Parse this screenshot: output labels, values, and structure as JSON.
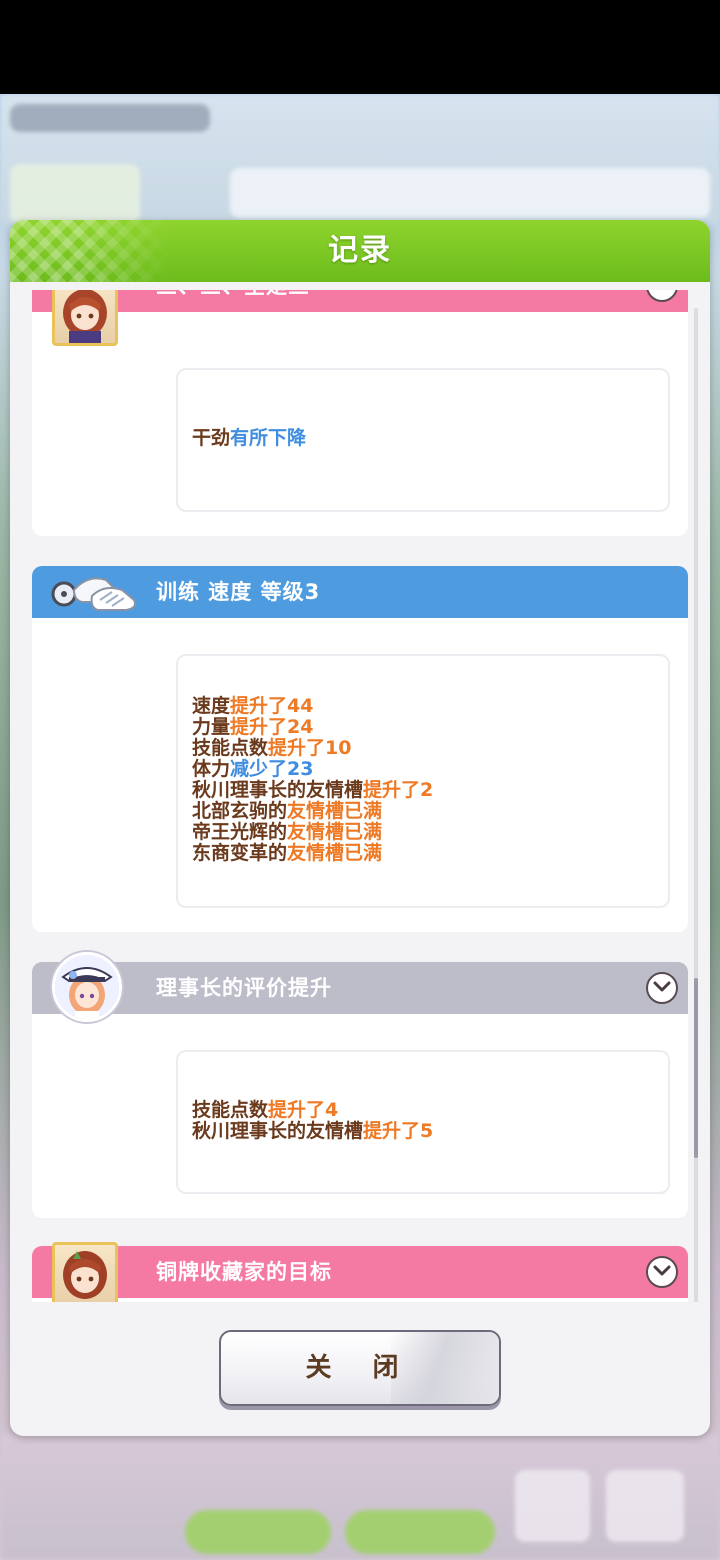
{
  "modal": {
    "title": "记录",
    "close_label": "关 闭"
  },
  "entries": [
    {
      "title": "三、三、全是三",
      "header_color": "#f57aa3",
      "icon": "character-portrait",
      "lines": [
        [
          {
            "text": "干劲",
            "color": "brown"
          },
          {
            "text": "有所下降",
            "color": "blue"
          }
        ]
      ]
    },
    {
      "title": "训练 速度 等级3",
      "header_color": "#4f9be0",
      "icon": "shoes-icon",
      "lines": [
        [
          {
            "text": "速度",
            "color": "brown"
          },
          {
            "text": "提升了44",
            "color": "orange"
          }
        ],
        [
          {
            "text": "力量",
            "color": "brown"
          },
          {
            "text": "提升了24",
            "color": "orange"
          }
        ],
        [
          {
            "text": "技能点数",
            "color": "brown"
          },
          {
            "text": "提升了10",
            "color": "orange"
          }
        ],
        [
          {
            "text": "体力",
            "color": "brown"
          },
          {
            "text": "减少了23",
            "color": "blue"
          }
        ],
        [
          {
            "text": "秋川理事长的友情槽",
            "color": "brown"
          },
          {
            "text": "提升了2",
            "color": "orange"
          }
        ],
        [
          {
            "text": "北部玄驹的",
            "color": "brown"
          },
          {
            "text": "友情槽已满",
            "color": "orange"
          }
        ],
        [
          {
            "text": "帝王光辉的",
            "color": "brown"
          },
          {
            "text": "友情槽已满",
            "color": "orange"
          }
        ],
        [
          {
            "text": "东商变革的",
            "color": "brown"
          },
          {
            "text": "友情槽已满",
            "color": "orange"
          }
        ]
      ]
    },
    {
      "title": "理事长的评价提升",
      "header_color": "#bdbdca",
      "icon": "chairwoman-portrait",
      "lines": [
        [
          {
            "text": "技能点数",
            "color": "brown"
          },
          {
            "text": "提升了4",
            "color": "orange"
          }
        ],
        [
          {
            "text": "秋川理事长的友情槽",
            "color": "brown"
          },
          {
            "text": "提升了5",
            "color": "orange"
          }
        ]
      ]
    },
    {
      "title": "铜牌收藏家的目标",
      "header_color": "#f57aa3",
      "icon": "character-portrait"
    }
  ],
  "colors": {
    "header_green": "#7cc624",
    "text_brown": "#6b3a1c",
    "text_orange": "#ee7a26",
    "text_blue": "#3f8de0"
  }
}
